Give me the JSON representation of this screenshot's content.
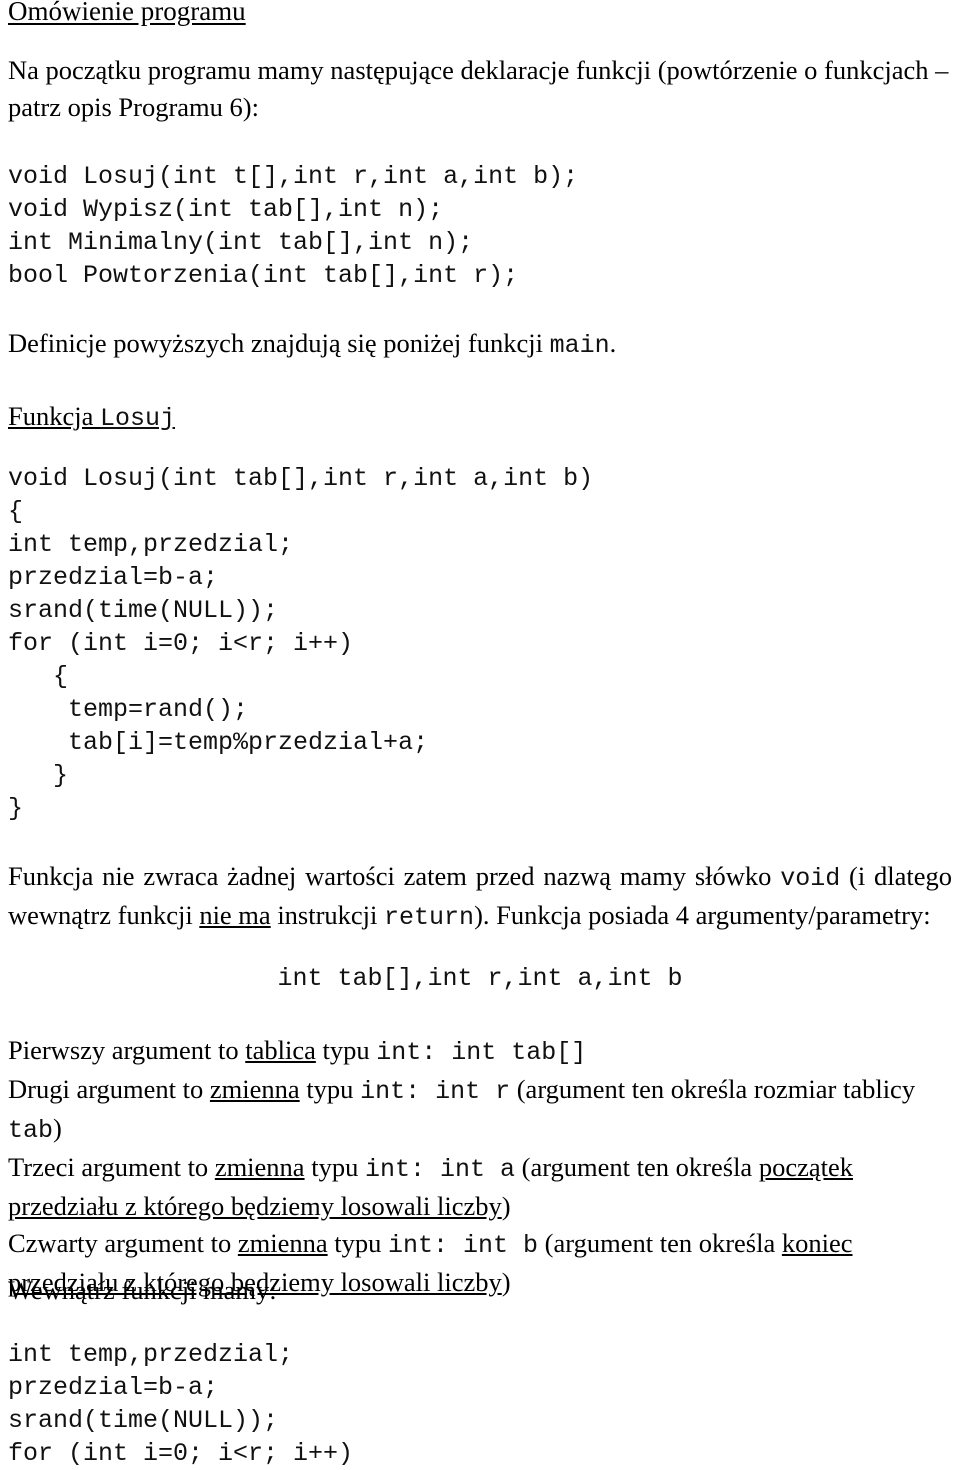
{
  "document": {
    "language": "pl",
    "heading": "Omówienie programu",
    "intro_paragraph": "Na początku programu mamy następujące deklaracje funkcji (powtórzenie o funkcjach – patrz opis Programu 6):",
    "declarations_code": "void Losuj(int t[],int r,int a,int b);\nvoid Wypisz(int tab[],int n);\nint Minimalny(int tab[],int n);\nbool Powtorzenia(int tab[],int r);",
    "definicje_line": {
      "text_before": "Definicje powyższych znajdują się poniżej funkcji ",
      "code": "main",
      "text_after": "."
    },
    "funkcja_losuj_heading": {
      "word": "Funkcja ",
      "code": "Losuj"
    },
    "losuj_code": "void Losuj(int tab[],int r,int a,int b)\n{\nint temp,przedzial;\nprzedzial=b-a;\nsrand(time(NULL));\nfor (int i=0; i<r; i++)\n   {\n    temp=rand();\n    tab[i]=temp%przedzial+a;\n   }\n}",
    "void_paragraph": {
      "part1": "Funkcja nie zwraca żadnej wartości zatem przed nazwą mamy słówko ",
      "code1": "void",
      "part2": " (i dlatego wewnątrz funkcji ",
      "underlined1": "nie ma",
      "part3": " instrukcji ",
      "code2": "return",
      "part4": "). Funkcja posiada 4 argumenty/parametry:"
    },
    "signature_code": "int tab[],int r,int a,int b",
    "arguments": [
      {
        "prefix": "Pierwszy argument to ",
        "underlined": "tablica",
        "middle": " typu ",
        "code_type": "int",
        "colon": ": ",
        "code_decl": "int tab[]",
        "suffix": ""
      },
      {
        "prefix": "Drugi argument to ",
        "underlined": "zmienna",
        "middle": " typu ",
        "code_type": "int",
        "colon": ": ",
        "code_decl": "int r",
        "suffix": " (argument ten określa rozmiar tablicy ",
        "code_tail": "tab",
        "suffix2": ")"
      },
      {
        "prefix": "Trzeci argument to ",
        "underlined": "zmienna",
        "middle": " typu ",
        "code_type": "int",
        "colon": ": ",
        "code_decl": "int  a",
        "suffix": " (argument ten określa ",
        "underlined_tail": "początek przedziału z którego będziemy losowali liczby",
        "suffix2": ")"
      },
      {
        "prefix": "Czwarty argument to ",
        "underlined": "zmienna",
        "middle": " typu ",
        "code_type": "int",
        "colon": ": ",
        "code_decl": "int b",
        "suffix": " (argument ten określa ",
        "underlined_tail": "koniec przedziału z którego będziemy losowali liczby",
        "suffix2": ")"
      }
    ],
    "wewnatrz_line": "Wewnątrz funkcji mamy:",
    "tail_code": "int temp,przedzial;\nprzedzial=b-a;\nsrand(time(NULL));\nfor (int i=0; i<r; i++)"
  },
  "colors": {
    "page_background": "#ffffff",
    "body_text": "#000000",
    "code_text": "#111111"
  }
}
